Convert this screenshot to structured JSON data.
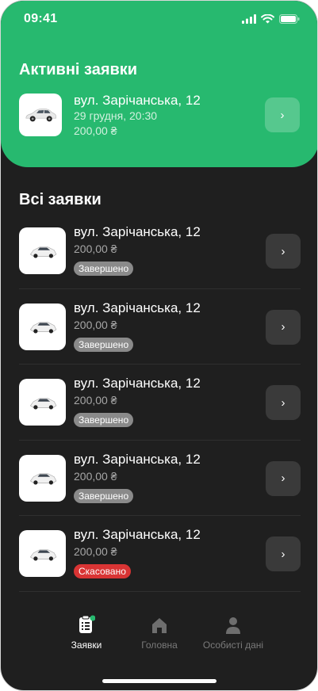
{
  "status_bar": {
    "time": "09:41"
  },
  "active": {
    "title": "Активні заявки",
    "item": {
      "address": "вул. Зарічанська, 12",
      "datetime": "29 грудня, 20:30",
      "price": "200,00 ₴"
    }
  },
  "all": {
    "title": "Всі заявки",
    "items": [
      {
        "address": "вул. Зарічанська, 12",
        "price": "200,00 ₴",
        "status": "Завершено",
        "status_color": "#8a8a8a"
      },
      {
        "address": "вул. Зарічанська, 12",
        "price": "200,00 ₴",
        "status": "Завершено",
        "status_color": "#8a8a8a"
      },
      {
        "address": "вул. Зарічанська, 12",
        "price": "200,00 ₴",
        "status": "Завершено",
        "status_color": "#8a8a8a"
      },
      {
        "address": "вул. Зарічанська, 12",
        "price": "200,00 ₴",
        "status": "Завершено",
        "status_color": "#8a8a8a"
      },
      {
        "address": "вул. Зарічанська, 12",
        "price": "200,00 ₴",
        "status": "Скасовано",
        "status_color": "#d93434"
      }
    ]
  },
  "nav": {
    "items": [
      {
        "label": "Заявки",
        "icon": "clipboard-icon",
        "active": true
      },
      {
        "label": "Головна",
        "icon": "home-icon",
        "active": false
      },
      {
        "label": "Особисті дані",
        "icon": "person-icon",
        "active": false
      }
    ]
  },
  "colors": {
    "accent": "#27b96f",
    "background": "#1f1f1f",
    "cancel": "#d93434",
    "done": "#8a8a8a"
  }
}
